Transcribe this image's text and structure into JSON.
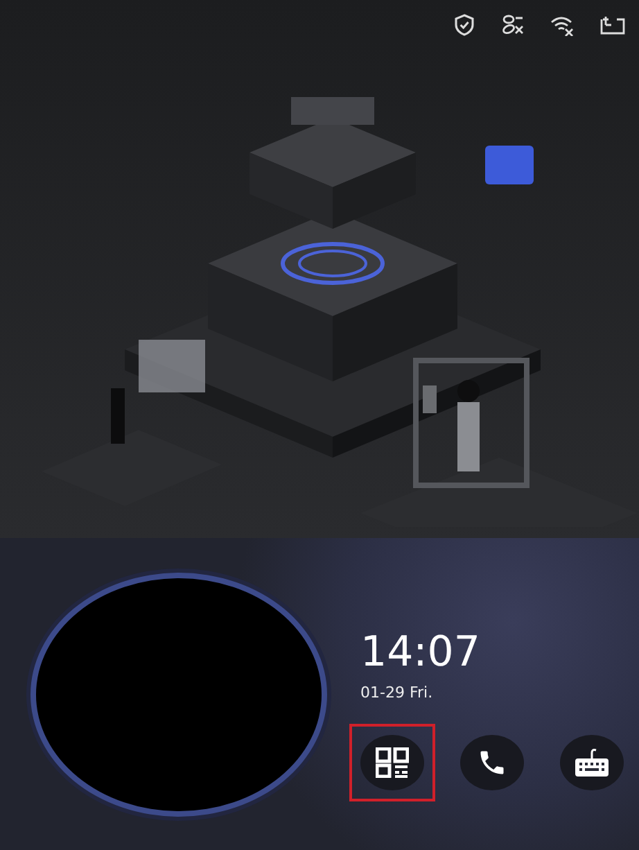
{
  "status_bar": {
    "icons": [
      {
        "kind": "shield"
      },
      {
        "kind": "link-off"
      },
      {
        "kind": "wifi-off"
      },
      {
        "kind": "network"
      }
    ]
  },
  "clock": {
    "time": "14:07",
    "date": "01-29 Fri."
  },
  "actions": [
    {
      "kind": "qr",
      "highlighted": true
    },
    {
      "kind": "call",
      "highlighted": false
    },
    {
      "kind": "keypad",
      "highlighted": false
    }
  ]
}
